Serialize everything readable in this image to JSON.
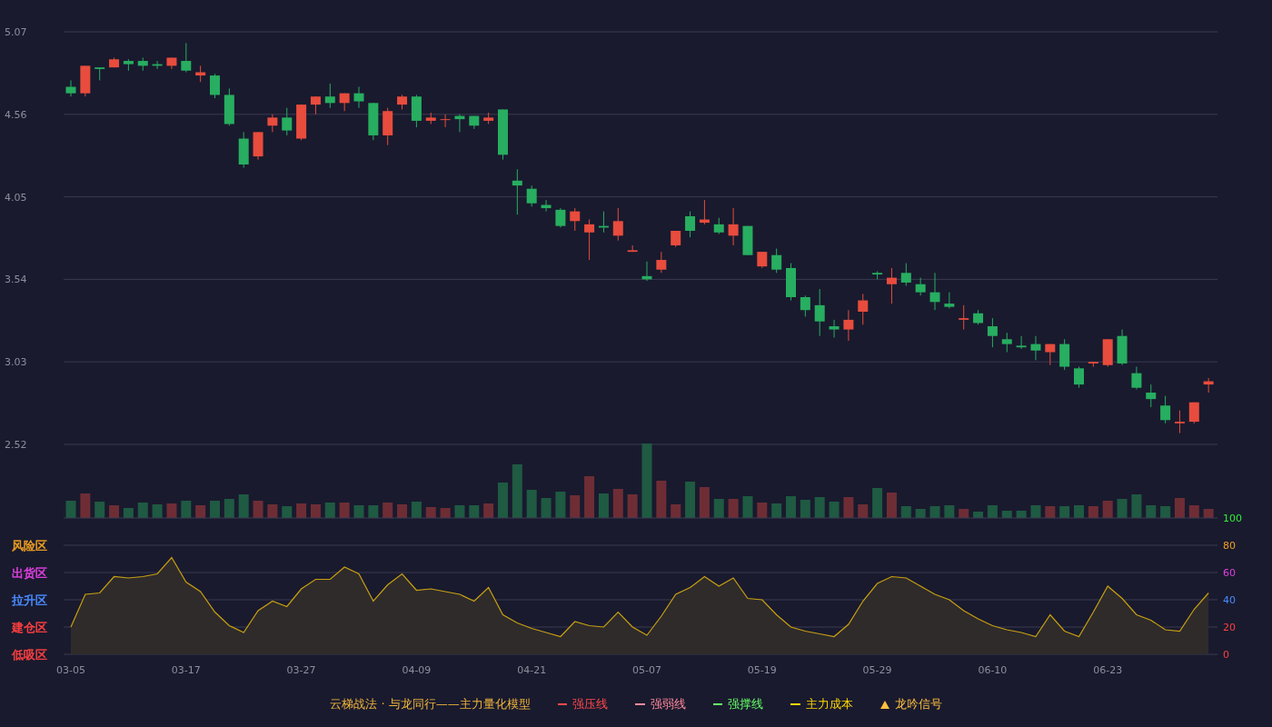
{
  "price_chart": {
    "chart_data": {
      "type": "candlestick",
      "grid": true,
      "ylim": [
        2.52,
        5.07
      ],
      "yticks": [
        5.07,
        4.56,
        4.05,
        3.54,
        3.03,
        2.52
      ],
      "categories": [
        null,
        null,
        null,
        null,
        null,
        null,
        null,
        null,
        null,
        null,
        null,
        null,
        null,
        null,
        null,
        null,
        null,
        null,
        null,
        null,
        null,
        null,
        null,
        null,
        null,
        null,
        null,
        null,
        null,
        null,
        null,
        null,
        null,
        null,
        null,
        null,
        null,
        null,
        null,
        null,
        null,
        null,
        null,
        null,
        null,
        null,
        null,
        null,
        null,
        null,
        null,
        null,
        null,
        null,
        null,
        null,
        null,
        null,
        null,
        null,
        null,
        null,
        null,
        null,
        null,
        null,
        null,
        null,
        null,
        null,
        null,
        null,
        null,
        null,
        null,
        null,
        null,
        null,
        null,
        null
      ],
      "ohlc": [
        [
          4.73,
          4.77,
          4.67,
          4.69
        ],
        [
          4.69,
          4.86,
          4.67,
          4.86
        ],
        [
          4.85,
          4.85,
          4.77,
          4.84
        ],
        [
          4.85,
          4.91,
          4.85,
          4.9
        ],
        [
          4.89,
          4.9,
          4.83,
          4.87
        ],
        [
          4.89,
          4.91,
          4.83,
          4.86
        ],
        [
          4.87,
          4.89,
          4.84,
          4.86
        ],
        [
          4.86,
          4.91,
          4.84,
          4.91
        ],
        [
          4.89,
          5.0,
          4.82,
          4.83
        ],
        [
          4.8,
          4.86,
          4.76,
          4.82
        ],
        [
          4.8,
          4.81,
          4.66,
          4.68
        ],
        [
          4.68,
          4.72,
          4.49,
          4.5
        ],
        [
          4.41,
          4.45,
          4.23,
          4.25
        ],
        [
          4.3,
          4.45,
          4.28,
          4.45
        ],
        [
          4.49,
          4.56,
          4.45,
          4.54
        ],
        [
          4.54,
          4.6,
          4.43,
          4.46
        ],
        [
          4.41,
          4.62,
          4.4,
          4.62
        ],
        [
          4.62,
          4.67,
          4.56,
          4.67
        ],
        [
          4.67,
          4.75,
          4.6,
          4.63
        ],
        [
          4.63,
          4.69,
          4.58,
          4.69
        ],
        [
          4.69,
          4.73,
          4.6,
          4.64
        ],
        [
          4.63,
          4.63,
          4.4,
          4.43
        ],
        [
          4.43,
          4.6,
          4.37,
          4.58
        ],
        [
          4.62,
          4.68,
          4.59,
          4.67
        ],
        [
          4.67,
          4.68,
          4.48,
          4.52
        ],
        [
          4.52,
          4.57,
          4.5,
          4.54
        ],
        [
          4.53,
          4.56,
          4.48,
          4.53
        ],
        [
          4.55,
          4.56,
          4.45,
          4.53
        ],
        [
          4.55,
          4.55,
          4.47,
          4.49
        ],
        [
          4.52,
          4.57,
          4.5,
          4.54
        ],
        [
          4.59,
          4.59,
          4.28,
          4.31
        ],
        [
          4.15,
          4.22,
          3.94,
          4.12
        ],
        [
          4.1,
          4.12,
          3.99,
          4.01
        ],
        [
          4.0,
          4.03,
          3.96,
          3.98
        ],
        [
          3.97,
          3.98,
          3.86,
          3.87
        ],
        [
          3.9,
          3.98,
          3.84,
          3.96
        ],
        [
          3.83,
          3.91,
          3.66,
          3.88
        ],
        [
          3.87,
          3.96,
          3.83,
          3.86
        ],
        [
          3.81,
          3.98,
          3.78,
          3.9
        ],
        [
          3.71,
          3.75,
          3.71,
          3.72
        ],
        [
          3.56,
          3.65,
          3.53,
          3.54
        ],
        [
          3.6,
          3.71,
          3.58,
          3.66
        ],
        [
          3.75,
          3.84,
          3.74,
          3.84
        ],
        [
          3.93,
          3.96,
          3.8,
          3.84
        ],
        [
          3.89,
          4.03,
          3.88,
          3.91
        ],
        [
          3.88,
          3.92,
          3.82,
          3.83
        ],
        [
          3.81,
          3.98,
          3.75,
          3.88
        ],
        [
          3.87,
          3.87,
          3.69,
          3.69
        ],
        [
          3.62,
          3.71,
          3.61,
          3.71
        ],
        [
          3.69,
          3.73,
          3.58,
          3.6
        ],
        [
          3.61,
          3.64,
          3.41,
          3.43
        ],
        [
          3.43,
          3.44,
          3.31,
          3.35
        ],
        [
          3.38,
          3.48,
          3.19,
          3.28
        ],
        [
          3.25,
          3.29,
          3.18,
          3.23
        ],
        [
          3.23,
          3.35,
          3.16,
          3.29
        ],
        [
          3.34,
          3.45,
          3.26,
          3.41
        ],
        [
          3.58,
          3.59,
          3.54,
          3.57
        ],
        [
          3.51,
          3.61,
          3.39,
          3.55
        ],
        [
          3.58,
          3.64,
          3.5,
          3.52
        ],
        [
          3.51,
          3.55,
          3.44,
          3.46
        ],
        [
          3.46,
          3.58,
          3.35,
          3.4
        ],
        [
          3.39,
          3.46,
          3.36,
          3.37
        ],
        [
          3.29,
          3.38,
          3.23,
          3.3
        ],
        [
          3.33,
          3.35,
          3.26,
          3.27
        ],
        [
          3.25,
          3.3,
          3.12,
          3.19
        ],
        [
          3.17,
          3.21,
          3.09,
          3.14
        ],
        [
          3.13,
          3.19,
          3.11,
          3.12
        ],
        [
          3.14,
          3.19,
          3.04,
          3.1
        ],
        [
          3.09,
          3.14,
          3.01,
          3.14
        ],
        [
          3.14,
          3.17,
          2.98,
          3.0
        ],
        [
          2.99,
          3.0,
          2.87,
          2.89
        ],
        [
          3.02,
          3.03,
          3.0,
          3.03
        ],
        [
          3.01,
          3.17,
          3.0,
          3.17
        ],
        [
          3.19,
          3.23,
          3.01,
          3.02
        ],
        [
          2.96,
          3.0,
          2.86,
          2.87
        ],
        [
          2.84,
          2.89,
          2.75,
          2.8
        ],
        [
          2.76,
          2.82,
          2.65,
          2.67
        ],
        [
          2.65,
          2.73,
          2.59,
          2.66
        ],
        [
          2.66,
          2.78,
          2.65,
          2.78
        ],
        [
          2.89,
          2.93,
          2.84,
          2.91
        ]
      ]
    }
  },
  "indicator_chart": {
    "zones": [
      {
        "label": "风险区",
        "color": "#f0a020"
      },
      {
        "label": "出货区",
        "color": "#e040e0"
      },
      {
        "label": "拉升区",
        "color": "#4a8cff"
      },
      {
        "label": "建仓区",
        "color": "#ff4040"
      },
      {
        "label": "低吸区",
        "color": "#ff4040"
      }
    ],
    "scale": [
      {
        "label": "100",
        "color": "#33ee33"
      },
      {
        "label": "80",
        "color": "#f0a020"
      },
      {
        "label": "60",
        "color": "#e040e0"
      },
      {
        "label": "40",
        "color": "#4a8cff"
      },
      {
        "label": "20",
        "color": "#ff4040"
      },
      {
        "label": "0",
        "color": "#ff4040"
      }
    ],
    "chart_data": {
      "type": "area",
      "grid": true,
      "ylim": [
        0,
        100
      ],
      "yticks": [
        100,
        80,
        60,
        40,
        20,
        0
      ],
      "categories": [
        "03-05",
        null,
        null,
        null,
        null,
        null,
        null,
        null,
        "03-17",
        null,
        null,
        null,
        null,
        null,
        null,
        null,
        "03-27",
        null,
        null,
        null,
        null,
        null,
        null,
        null,
        "04-09",
        null,
        null,
        null,
        null,
        null,
        null,
        null,
        "04-21",
        null,
        null,
        null,
        null,
        null,
        null,
        null,
        "05-07",
        null,
        null,
        null,
        null,
        null,
        null,
        null,
        "05-19",
        null,
        null,
        null,
        null,
        null,
        null,
        null,
        "05-29",
        null,
        null,
        null,
        null,
        null,
        null,
        null,
        "06-10",
        null,
        null,
        null,
        null,
        null,
        null,
        null,
        "06-23",
        null,
        null,
        null,
        null,
        null,
        null,
        null
      ],
      "series": [
        {
          "color": "#c8a010",
          "values": [
            20,
            44,
            45,
            57,
            56,
            57,
            59,
            71,
            53,
            46,
            31,
            21,
            16,
            32,
            39,
            35,
            48,
            55,
            55,
            64,
            59,
            39,
            51,
            59,
            47,
            48,
            46,
            44,
            39,
            49,
            29,
            23,
            19,
            16,
            13,
            24,
            21,
            20,
            31,
            20,
            14,
            28,
            44,
            49,
            57,
            50,
            56,
            41,
            40,
            29,
            20,
            17,
            15,
            13,
            22,
            39,
            52,
            57,
            56,
            50,
            44,
            40,
            32,
            26,
            21,
            18,
            16,
            13,
            29,
            17,
            13,
            31,
            50,
            41,
            29,
            25,
            18,
            17,
            33,
            45
          ]
        }
      ]
    }
  },
  "legend": {
    "title": "云梯战法 · 与龙同行——主力量化模型",
    "items": [
      {
        "kind": "solid",
        "label": "强压线",
        "color": "#ff4a4a"
      },
      {
        "kind": "dashed",
        "label": "强弱线",
        "color": "#ff8a9a"
      },
      {
        "kind": "solid",
        "label": "强撑线",
        "color": "#66ff66"
      },
      {
        "kind": "dashed",
        "label": "主力成本",
        "color": "#ffd700"
      },
      {
        "kind": "triangle",
        "label": "龙吟信号",
        "color": "#ffc040"
      }
    ]
  }
}
